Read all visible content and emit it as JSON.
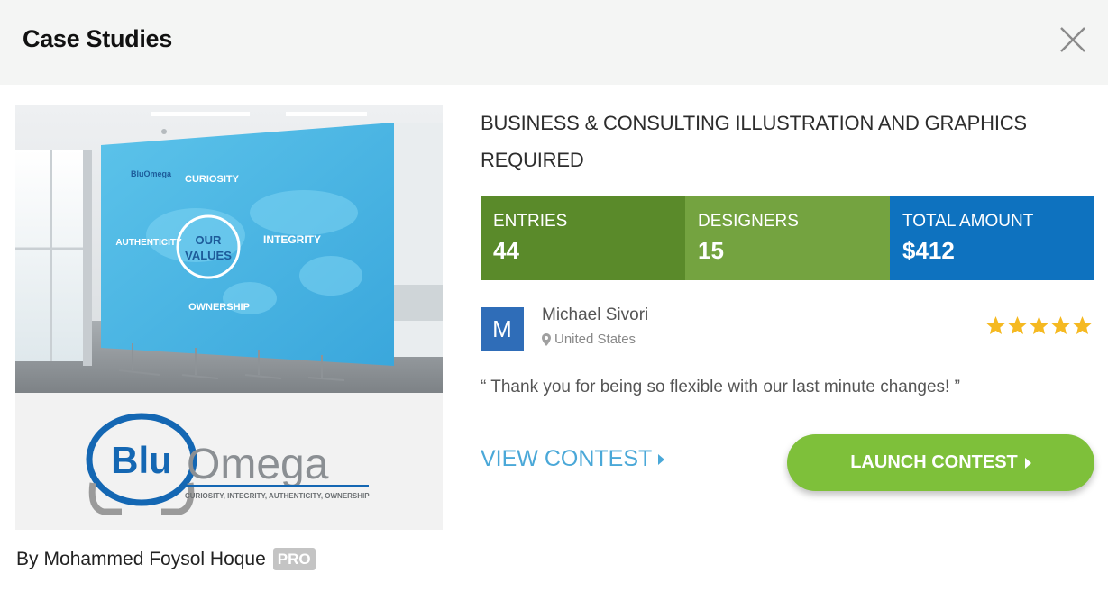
{
  "modal": {
    "title": "Case Studies",
    "close_icon": "close-icon"
  },
  "case_image": {
    "wall_texts": {
      "brand_small": "BluOmega",
      "curiosity": "CURIOSITY",
      "authenticity": "AUTHENTICITY",
      "our": "OUR",
      "values": "VALUES",
      "integrity": "INTEGRITY",
      "ownership": "OWNERSHIP"
    }
  },
  "logo": {
    "blu": "Blu",
    "omega": "Omega",
    "tagline": "CURIOSITY, INTEGRITY, AUTHENTICITY, OWNERSHIP"
  },
  "byline": {
    "prefix": "By",
    "designer": "Mohammed Foysol Hoque",
    "badge": "PRO"
  },
  "project": {
    "title": "Business & Consulting Illustration and Graphics Required"
  },
  "stats": {
    "entries_label": "ENTRIES",
    "entries_value": "44",
    "designers_label": "DESIGNERS",
    "designers_value": "15",
    "amount_label": "TOTAL AMOUNT",
    "amount_value": "$412"
  },
  "client": {
    "avatar_initial": "M",
    "name": "Michael Sivori",
    "location": "United States",
    "rating": 5
  },
  "testimonial": "“ Thank you for being so flexible with our last minute changes! ”",
  "actions": {
    "view_contest": "VIEW CONTEST",
    "launch_contest": "LAUNCH CONTEST"
  },
  "colors": {
    "entries_bg": "#5a8a2a",
    "designers_bg": "#74a340",
    "amount_bg": "#0e72bf",
    "launch_bg": "#7ec03a",
    "link": "#4aa8d8",
    "star": "#f5b921"
  }
}
